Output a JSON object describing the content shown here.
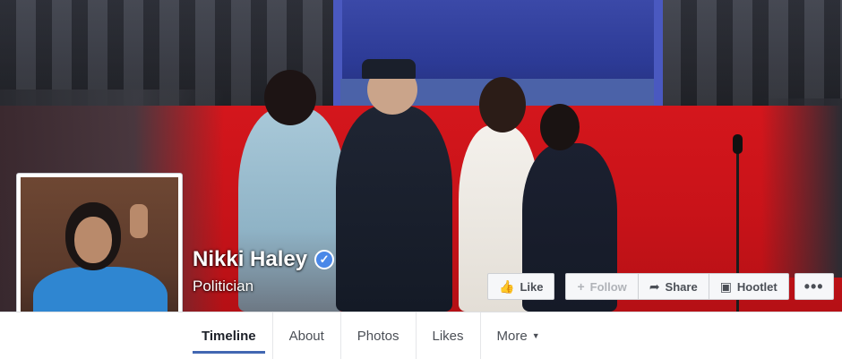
{
  "page": {
    "name": "Nikki Haley",
    "category": "Politician",
    "verified": true
  },
  "actions": {
    "like": "Like",
    "follow": "Follow",
    "share": "Share",
    "hootlet": "Hootlet",
    "more": "•••"
  },
  "tabs": [
    {
      "label": "Timeline",
      "active": true
    },
    {
      "label": "About",
      "active": false
    },
    {
      "label": "Photos",
      "active": false
    },
    {
      "label": "Likes",
      "active": false
    },
    {
      "label": "More",
      "active": false
    }
  ],
  "colors": {
    "accent": "#4267b2",
    "verified": "#4a88e8",
    "carpet": "#d0151b"
  },
  "icons": {
    "like": "thumbs-up-icon",
    "follow": "plus-icon",
    "share": "share-arrow-icon",
    "hootlet": "owl-icon",
    "verified": "checkmark-icon",
    "more_tab": "caret-down-icon"
  }
}
